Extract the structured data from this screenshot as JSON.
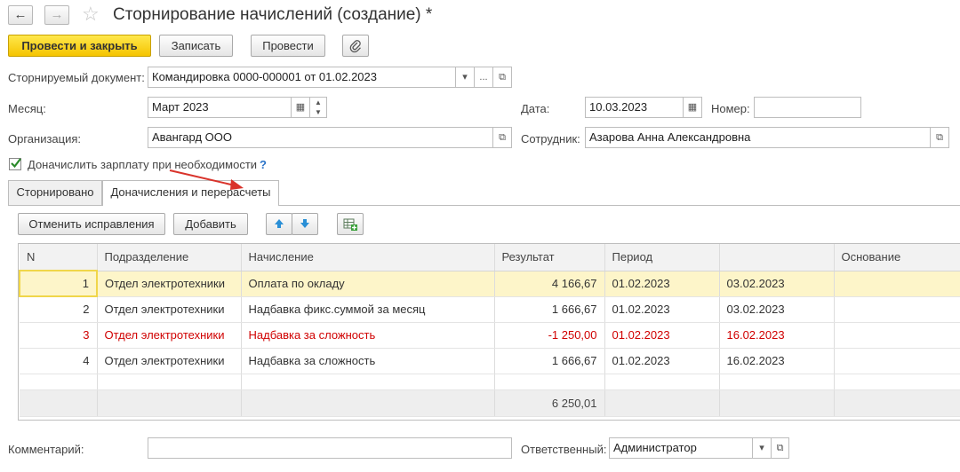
{
  "window": {
    "title": "Сторнирование начислений (создание) *"
  },
  "toolbar": {
    "post_close": "Провести и закрыть",
    "save": "Записать",
    "post": "Провести"
  },
  "form": {
    "reversed_doc_label": "Сторнируемый документ:",
    "reversed_doc_value": "Командировка 0000-000001 от 01.02.2023",
    "month_label": "Месяц:",
    "month_value": "Март 2023",
    "date_label": "Дата:",
    "date_value": "10.03.2023",
    "number_label": "Номер:",
    "number_value": "",
    "org_label": "Организация:",
    "org_value": "Авангард ООО",
    "employee_label": "Сотрудник:",
    "employee_value": "Азарова Анна Александровна",
    "accrue_checkbox_label": "Доначислить зарплату при необходимости",
    "help_mark": "?",
    "ellipsis": "..."
  },
  "tabs": [
    {
      "label": "Сторнировано"
    },
    {
      "label": "Доначисления и перерасчеты"
    }
  ],
  "tab_toolbar": {
    "cancel_fixes": "Отменить исправления",
    "add": "Добавить"
  },
  "table": {
    "columns": [
      "N",
      "Подразделение",
      "Начисление",
      "Результат",
      "Период",
      "",
      "Основание"
    ],
    "rows": [
      {
        "n": "1",
        "dept": "Отдел электротехники",
        "accrual": "Оплата по окладу",
        "result": "4 166,67",
        "period_from": "01.02.2023",
        "period_to": "03.02.2023",
        "basis": ""
      },
      {
        "n": "2",
        "dept": "Отдел электротехники",
        "accrual": "Надбавка фикс.суммой за месяц",
        "result": "1 666,67",
        "period_from": "01.02.2023",
        "period_to": "03.02.2023",
        "basis": ""
      },
      {
        "n": "3",
        "dept": "Отдел электротехники",
        "accrual": "Надбавка за сложность",
        "result": "-1 250,00",
        "period_from": "01.02.2023",
        "period_to": "16.02.2023",
        "basis": ""
      },
      {
        "n": "4",
        "dept": "Отдел электротехники",
        "accrual": "Надбавка за сложность",
        "result": "1 666,67",
        "period_from": "01.02.2023",
        "period_to": "16.02.2023",
        "basis": ""
      }
    ],
    "total_result": "6 250,01"
  },
  "footer": {
    "comment_label": "Комментарий:",
    "comment_value": "",
    "responsible_label": "Ответственный:",
    "responsible_value": "Администратор"
  },
  "colors": {
    "primary_button": "#f5c400",
    "negative_row": "#d00000",
    "selected_row": "#fdf5c9",
    "annotation_arrow": "#d9332b",
    "checkbox_tick": "#2a8a2a",
    "help_mark": "#2a73c8"
  }
}
